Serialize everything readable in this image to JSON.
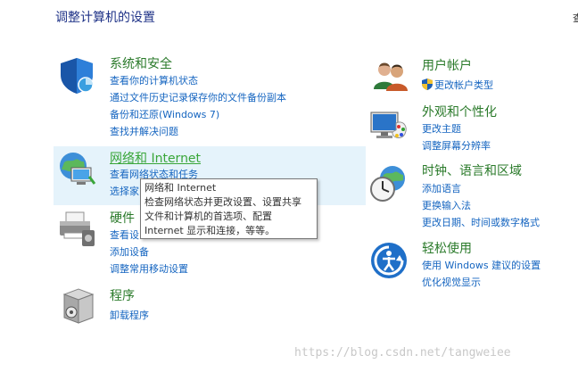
{
  "header": {
    "title": "调整计算机的设置",
    "view_by_partial": "查"
  },
  "categories": {
    "system": {
      "title": "系统和安全",
      "icon": "shield-icon",
      "links": [
        "查看你的计算机状态",
        "通过文件历史记录保存你的文件备份副本",
        "备份和还原(Windows 7)",
        "查找并解决问题"
      ]
    },
    "network": {
      "title": "网络和 Internet",
      "icon": "network-globe-icon",
      "links": [
        "查看网络状态和任务",
        "选择家"
      ]
    },
    "hardware": {
      "title": "硬件",
      "icon": "printer-icon",
      "links": [
        "查看设",
        "添加设备",
        "调整常用移动设置"
      ]
    },
    "programs": {
      "title": "程序",
      "icon": "programs-box-icon",
      "links": [
        "卸载程序"
      ]
    },
    "user": {
      "title": "用户帐户",
      "icon": "users-icon",
      "links": [
        "更改帐户类型"
      ]
    },
    "appearance": {
      "title": "外观和个性化",
      "icon": "monitor-palette-icon",
      "links": [
        "更改主题",
        "调整屏幕分辨率"
      ]
    },
    "clock": {
      "title": "时钟、语言和区域",
      "icon": "clock-globe-icon",
      "links": [
        "添加语言",
        "更换输入法",
        "更改日期、时间或数字格式"
      ]
    },
    "ease": {
      "title": "轻松使用",
      "icon": "ease-of-access-icon",
      "links": [
        "使用 Windows 建议的设置",
        "优化视觉显示"
      ]
    }
  },
  "tooltip": {
    "lines": [
      "网络和 Internet",
      "检查网络状态并更改设置、设置共享",
      "文件和计算机的首选项、配置",
      "Internet 显示和连接，等等。"
    ]
  },
  "watermark": "https://blog.csdn.net/tangweiee",
  "colors": {
    "title_green": "#2a7a2a",
    "link_blue": "#1565c0",
    "hover_bg": "#e5f3fb",
    "heading_blue": "#1e3287"
  }
}
